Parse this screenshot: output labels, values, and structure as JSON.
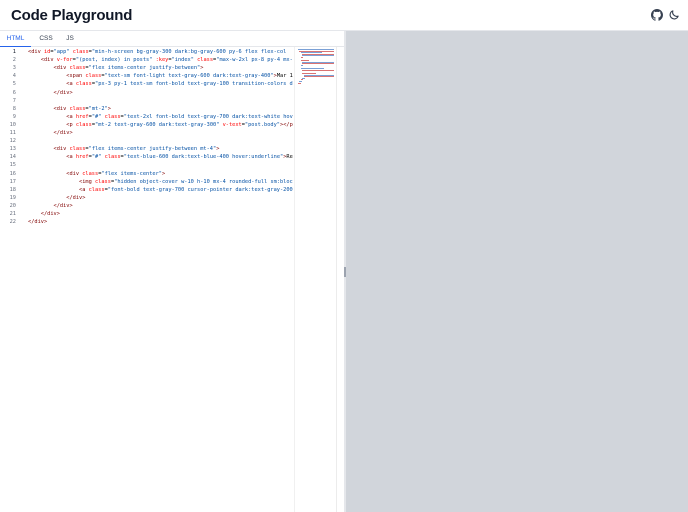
{
  "header": {
    "title": "Code Playground",
    "icons": [
      "github-icon",
      "moon-icon"
    ]
  },
  "tabs": [
    {
      "label": "HTML",
      "active": true
    },
    {
      "label": "CSS",
      "active": false
    },
    {
      "label": "JS",
      "active": false
    }
  ],
  "editor": {
    "line_numbers": [
      "1",
      "2",
      "3",
      "4",
      "5",
      "6",
      "7",
      "8",
      "9",
      "10",
      "11",
      "12",
      "13",
      "14",
      "15",
      "16",
      "17",
      "18",
      "19",
      "20",
      "21",
      "22"
    ],
    "lines": [
      "<div id=\"app\" class=\"min-h-screen bg-gray-300 dark:bg-gray-600 py-6 flex flex-col",
      "    <div v-for=\"(post, index) in posts\" :key=\"index\" class=\"max-w-2xl px-8 py-4 mx-",
      "        <div class=\"flex items-center justify-between\">",
      "            <span class=\"text-sm font-light text-gray-600 dark:text-gray-400\">Mar 1",
      "            <a class=\"px-3 py-1 text-sm font-bold text-gray-100 transition-colors d",
      "        </div>",
      "",
      "        <div class=\"mt-2\">",
      "            <a href=\"#\" class=\"text-2xl font-bold text-gray-700 dark:text-white hov",
      "            <p class=\"mt-2 text-gray-600 dark:text-gray-300\" v-text=\"post.body\"></p",
      "        </div>",
      "",
      "        <div class=\"flex items-center justify-between mt-4\">",
      "            <a href=\"#\" class=\"text-blue-600 dark:text-blue-400 hover:underline\">Re",
      "",
      "            <div class=\"flex items-center\">",
      "                <img class=\"hidden object-cover w-10 h-10 mx-4 rounded-full sm:bloc",
      "                <a class=\"font-bold text-gray-700 cursor-pointer dark:text-gray-200",
      "            </div>",
      "        </div>",
      "    </div>",
      "</div>"
    ]
  },
  "colors": {
    "accent": "#2563eb",
    "preview_bg": "#d1d5db",
    "tag": "#800000",
    "attr": "#ff0000",
    "string": "#0451a5"
  }
}
